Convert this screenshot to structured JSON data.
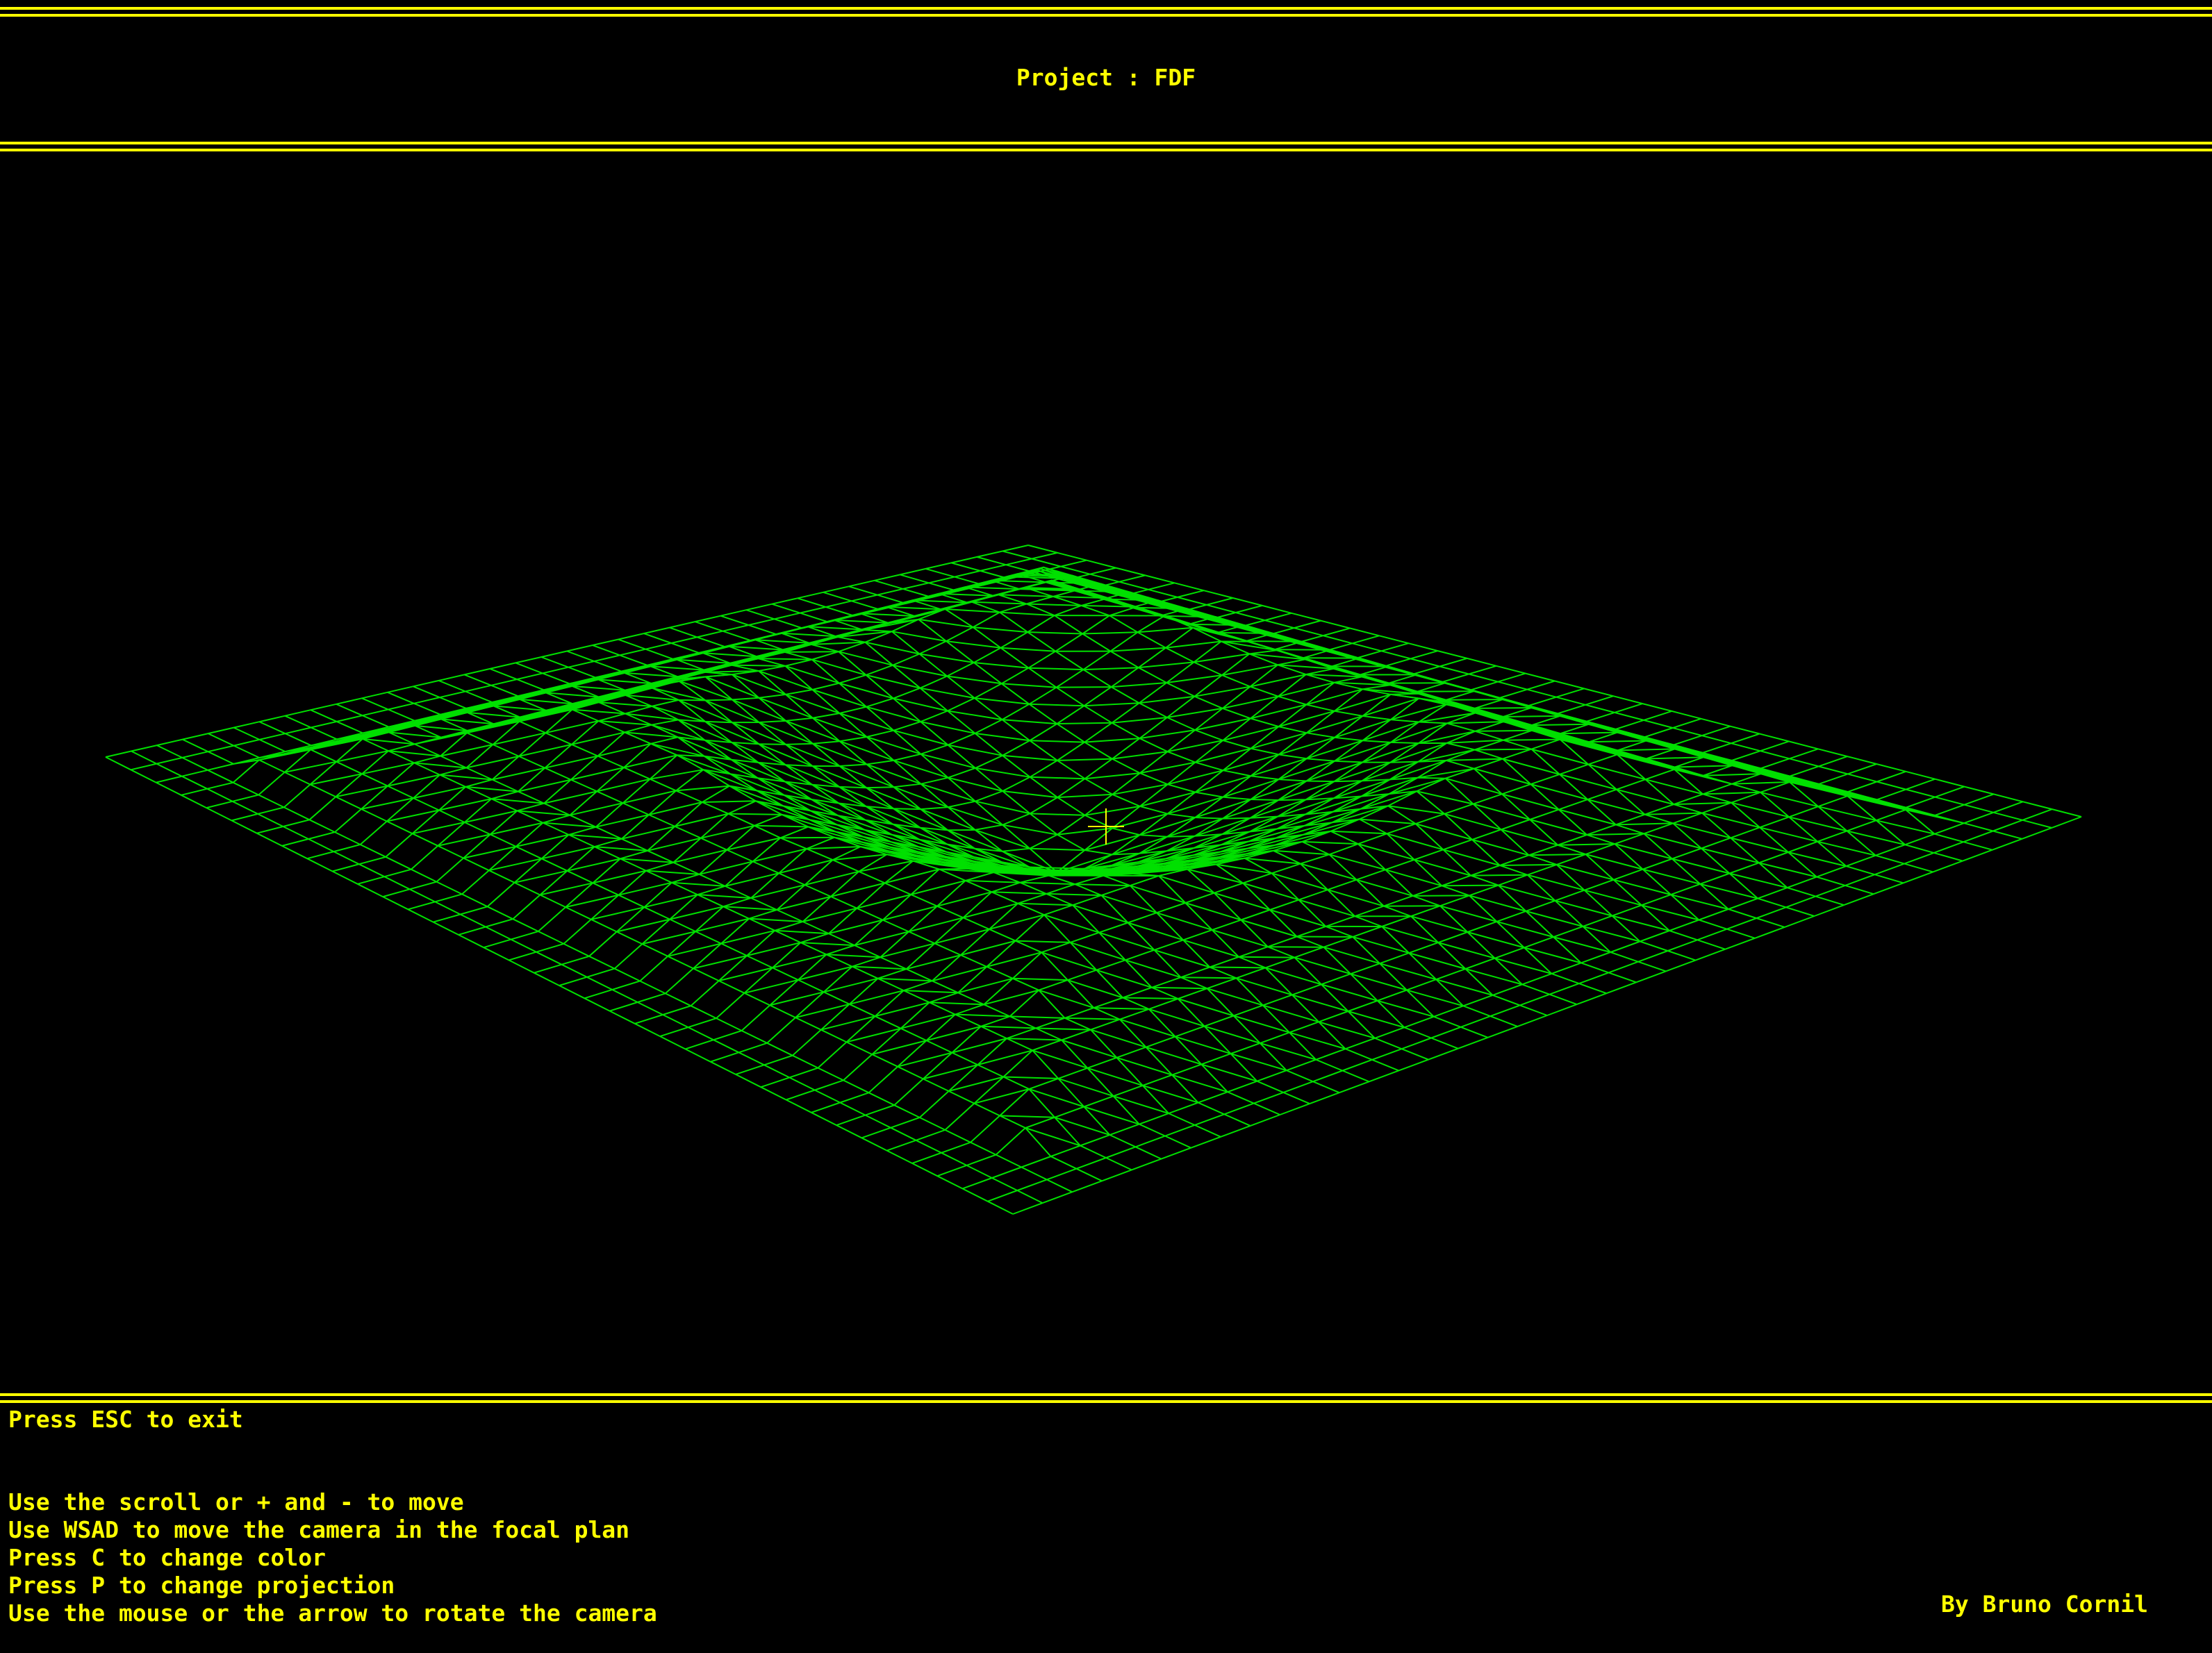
{
  "window": {
    "title": "Project : FDF"
  },
  "hud": {
    "exit_hint": "Press ESC to exit",
    "instructions": [
      "Use the scroll or + and - to move",
      "Use WSAD to move the camera in the focal plan",
      "Press C to change color",
      "Press P to change projection",
      "Use the mouse or the arrow to rotate the camera"
    ],
    "credit": "By Bruno Cornil"
  },
  "colors": {
    "background": "#000000",
    "ui_text": "#ffff00",
    "frame_lines": "#ffff00",
    "wireframe": "#00e000",
    "crosshair": "#ffff00"
  },
  "viewport": {
    "render": "wireframe-mesh",
    "crosshair_icon": "crosshair-icon"
  }
}
